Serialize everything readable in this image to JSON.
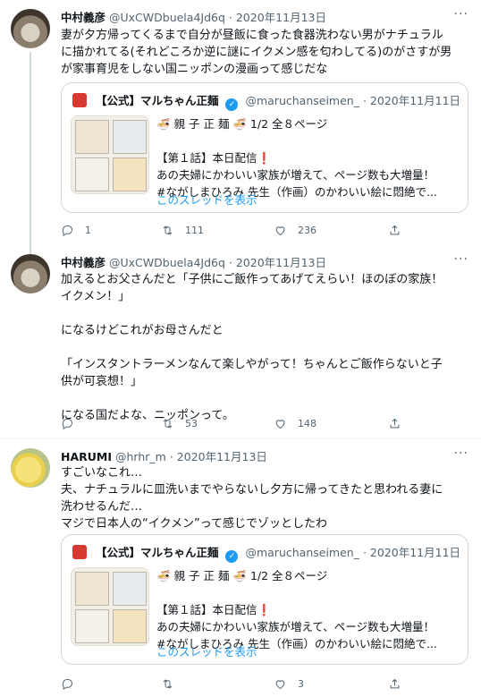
{
  "tweets": [
    {
      "name": "中村義彦",
      "handle": "@UxCWDbuela4Jd6q",
      "dot": "·",
      "date": "2020年11月13日",
      "more": "···",
      "body": "妻が夕方帰ってくるまで自分が昼飯に食った食器洗わない男がナチュラル\nに描かれてる(それどころか逆に謎にイクメン感を匂わしてる)のがさすが男\nが家事育児をしない国ニッポンの漫画って感じだな",
      "quote": {
        "name": "【公式】マルちゃん正麺",
        "verified": "✓",
        "handle": "@maruchanseimen_",
        "dot": "·",
        "date": "2020年11月11日",
        "text": "🍜 親 子 正 麺 🍜 1/2 全８ページ\n\n【第１話】本日配信❗\nあの夫婦にかわいい家族が増えて、ページ数も大増量！\n#ながしまひろみ 先生（作画）のかわいい絵に悶絶で...",
        "thread_link": "このスレッドを表示"
      },
      "counts": {
        "reply": "1",
        "retweet": "111",
        "like": "236"
      }
    },
    {
      "name": "中村義彦",
      "handle": "@UxCWDbuela4Jd6q",
      "dot": "·",
      "date": "2020年11月13日",
      "more": "···",
      "body": "加えるとお父さんだと「子供にご飯作ってあげてえらい！ほのぼの家族！\nイクメン！」\n\nになるけどこれがお母さんだと\n\n「インスタントラーメンなんて楽しやがって！ちゃんとご飯作らないと子\n供が可哀想！」\n\nになる国だよな、ニッポンって。",
      "counts": {
        "reply": "",
        "retweet": "53",
        "like": "148"
      }
    },
    {
      "name": "HARUMI",
      "handle": "@hrhr_m",
      "dot": "·",
      "date": "2020年11月13日",
      "more": "···",
      "body": "すごいなこれ…\n夫、ナチュラルに皿洗いまでやらないし夕方に帰ってきたと思われる妻に\n洗わせるんだ…\nマジで日本人の“イクメン”って感じでゾッとしたわ",
      "quote": {
        "name": "【公式】マルちゃん正麺",
        "verified": "✓",
        "handle": "@maruchanseimen_",
        "dot": "·",
        "date": "2020年11月11日",
        "text": "🍜 親 子 正 麺 🍜 1/2 全８ページ\n\n【第１話】本日配信❗\nあの夫婦にかわいい家族が増えて、ページ数も大増量！\n#ながしまひろみ 先生（作画）のかわいい絵に悶絶で...",
        "thread_link": "このスレッドを表示"
      },
      "counts": {
        "reply": "",
        "retweet": "",
        "like": "3"
      }
    }
  ]
}
